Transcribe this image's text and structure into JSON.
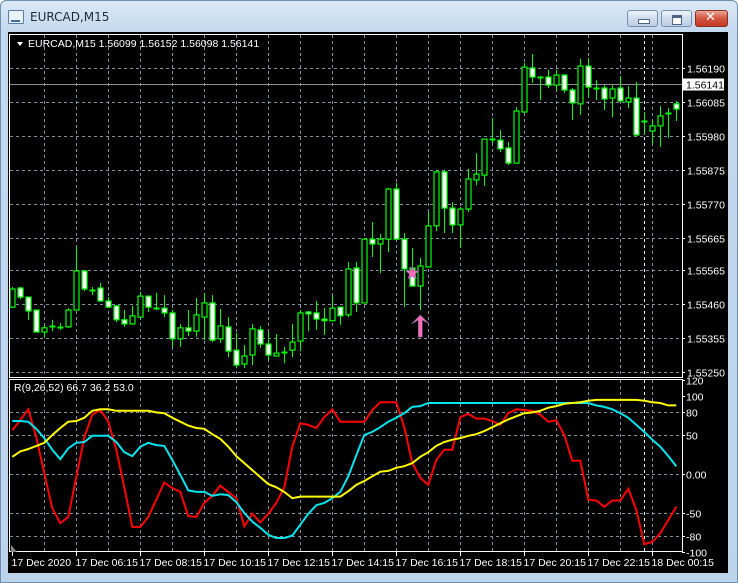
{
  "window": {
    "title": "EURCAD,M15",
    "buttons": {
      "minimize": "minimize",
      "maximize": "maximize",
      "close": "close"
    }
  },
  "chart_header": {
    "menu_icon": "triangle-down-icon",
    "text": "EURCAD,M15  1.56099 1.56152 1.56098 1.56141"
  },
  "indicator_header": {
    "text": "R(9,26,52) 66.7 36.2 53.0"
  },
  "colors": {
    "background": "#000000",
    "candle_outline": "#00ff00",
    "bear_body": "#ffffff",
    "bull_body": "#000000",
    "grid": "#8090a0",
    "red_line": "#ff0000",
    "cyan_line": "#00e5ee",
    "yellow_line": "#ffff00",
    "signal": "#ff6eb4"
  },
  "chart_data": [
    {
      "type": "candlestick",
      "symbol": "EURCAD",
      "timeframe": "M15",
      "bid": 1.56141,
      "bid_label": "1.56141",
      "y_ticks": [
        "1.56190",
        "1.56085",
        "1.55980",
        "1.55875",
        "1.55770",
        "1.55665",
        "1.55565",
        "1.55460",
        "1.55355",
        "1.55250"
      ],
      "x_tick_labels": [
        "17 Dec 2020",
        "17 Dec 06:15",
        "17 Dec 08:15",
        "17 Dec 10:15",
        "17 Dec 12:15",
        "17 Dec 14:15",
        "17 Dec 16:15",
        "17 Dec 18:15",
        "17 Dec 20:15",
        "17 Dec 22:15",
        "18 Dec 00:15"
      ],
      "grid": true,
      "day_separator_before": "18 Dec 00:15",
      "ohlc": [
        [
          1.55451,
          1.55513,
          1.55448,
          1.55507
        ],
        [
          1.5551,
          1.55513,
          1.55476,
          1.55482
        ],
        [
          1.55482,
          1.55482,
          1.55412,
          1.55439
        ],
        [
          1.55442,
          1.55442,
          1.55374,
          1.55374
        ],
        [
          1.55374,
          1.55396,
          1.55359,
          1.55387
        ],
        [
          1.55393,
          1.55412,
          1.55377,
          1.55393
        ],
        [
          1.5539,
          1.55402,
          1.55381,
          1.5539
        ],
        [
          1.5539,
          1.55448,
          1.55387,
          1.55442
        ],
        [
          1.55442,
          1.55637,
          1.55442,
          1.55563
        ],
        [
          1.55563,
          1.55563,
          1.55501,
          1.55507
        ],
        [
          1.55504,
          1.55513,
          1.55488,
          1.55504
        ],
        [
          1.5551,
          1.55526,
          1.55467,
          1.5547
        ],
        [
          1.5547,
          1.55482,
          1.55448,
          1.55451
        ],
        [
          1.55455,
          1.55458,
          1.55405,
          1.55412
        ],
        [
          1.55412,
          1.55442,
          1.5539,
          1.55399
        ],
        [
          1.55399,
          1.55455,
          1.55396,
          1.55424
        ],
        [
          1.5542,
          1.55498,
          1.5542,
          1.55485
        ],
        [
          1.55485,
          1.55485,
          1.55436,
          1.55451
        ],
        [
          1.55448,
          1.55495,
          1.55442,
          1.55448
        ],
        [
          1.55448,
          1.55488,
          1.5542,
          1.55433
        ],
        [
          1.55433,
          1.55442,
          1.55328,
          1.55353
        ],
        [
          1.55353,
          1.55399,
          1.55328,
          1.55387
        ],
        [
          1.55387,
          1.55442,
          1.55362,
          1.55377
        ],
        [
          1.55377,
          1.55479,
          1.55359,
          1.55427
        ],
        [
          1.5542,
          1.55495,
          1.55349,
          1.55464
        ],
        [
          1.55464,
          1.55488,
          1.55343,
          1.55349
        ],
        [
          1.55353,
          1.55445,
          1.5534,
          1.55393
        ],
        [
          1.5539,
          1.5542,
          1.55297,
          1.55315
        ],
        [
          1.55318,
          1.55371,
          1.55263,
          1.55272
        ],
        [
          1.55275,
          1.55334,
          1.55263,
          1.553
        ],
        [
          1.55303,
          1.55399,
          1.55272,
          1.55384
        ],
        [
          1.55381,
          1.55393,
          1.55325,
          1.55337
        ],
        [
          1.55337,
          1.55374,
          1.55288,
          1.55303
        ],
        [
          1.553,
          1.55368,
          1.553,
          1.55309
        ],
        [
          1.55312,
          1.55328,
          1.55278,
          1.55312
        ],
        [
          1.55318,
          1.55399,
          1.55297,
          1.55343
        ],
        [
          1.55346,
          1.55442,
          1.55315,
          1.55433
        ],
        [
          1.55436,
          1.55439,
          1.55377,
          1.5543
        ],
        [
          1.55433,
          1.5547,
          1.55381,
          1.55414
        ],
        [
          1.55414,
          1.55448,
          1.55365,
          1.55409
        ],
        [
          1.55409,
          1.55488,
          1.55409,
          1.55448
        ],
        [
          1.55451,
          1.55451,
          1.55396,
          1.55424
        ],
        [
          1.55427,
          1.5559,
          1.5542,
          1.55569
        ],
        [
          1.55572,
          1.5559,
          1.55436,
          1.55464
        ],
        [
          1.55464,
          1.55661,
          1.55464,
          1.55661
        ],
        [
          1.55661,
          1.55714,
          1.55606,
          1.55646
        ],
        [
          1.55646,
          1.55677,
          1.55556,
          1.55661
        ],
        [
          1.55661,
          1.55819,
          1.55621,
          1.55816
        ],
        [
          1.55816,
          1.55835,
          1.55661,
          1.55661
        ],
        [
          1.55661,
          1.5568,
          1.55451,
          1.55569
        ],
        [
          1.55572,
          1.55634,
          1.55516,
          1.55516
        ],
        [
          1.55516,
          1.55603,
          1.55442,
          1.55578
        ],
        [
          1.55575,
          1.55745,
          1.55575,
          1.55702
        ],
        [
          1.55702,
          1.55875,
          1.55686,
          1.55869
        ],
        [
          1.55869,
          1.55875,
          1.5568,
          1.55757
        ],
        [
          1.55757,
          1.55776,
          1.5568,
          1.55705
        ],
        [
          1.55705,
          1.5576,
          1.55634,
          1.55754
        ],
        [
          1.55754,
          1.55878,
          1.55745,
          1.55847
        ],
        [
          1.55844,
          1.55927,
          1.55828,
          1.55862
        ],
        [
          1.55859,
          1.5597,
          1.55825,
          1.5597
        ],
        [
          1.5597,
          1.56035,
          1.55958,
          1.5597
        ],
        [
          1.55967,
          1.55998,
          1.5593,
          1.5594
        ],
        [
          1.55943,
          1.55961,
          1.5589,
          1.55896
        ],
        [
          1.55896,
          1.56069,
          1.55896,
          1.56057
        ],
        [
          1.56054,
          1.56205,
          1.56051,
          1.56193
        ],
        [
          1.5619,
          1.56233,
          1.56144,
          1.56162
        ],
        [
          1.56162,
          1.56165,
          1.56091,
          1.56162
        ],
        [
          1.56162,
          1.56184,
          1.56128,
          1.56137
        ],
        [
          1.56137,
          1.56184,
          1.56119,
          1.56168
        ],
        [
          1.56168,
          1.56171,
          1.56113,
          1.56122
        ],
        [
          1.56122,
          1.56128,
          1.56029,
          1.56082
        ],
        [
          1.56079,
          1.56218,
          1.56045,
          1.56196
        ],
        [
          1.56196,
          1.56221,
          1.561,
          1.56131
        ],
        [
          1.56128,
          1.56153,
          1.56091,
          1.56128
        ],
        [
          1.56128,
          1.56137,
          1.5606,
          1.56094
        ],
        [
          1.56097,
          1.56137,
          1.56038,
          1.56125
        ],
        [
          1.56128,
          1.56165,
          1.56085,
          1.56088
        ],
        [
          1.56085,
          1.56134,
          1.56066,
          1.56097
        ],
        [
          1.56097,
          1.56147,
          1.5598,
          1.55983
        ],
        [
          1.56026,
          1.56054,
          1.55983,
          1.56023
        ],
        [
          1.55995,
          1.56029,
          1.55955,
          1.56011
        ],
        [
          1.56011,
          1.56072,
          1.55946,
          1.56042
        ],
        [
          1.56051,
          1.56066,
          1.55974,
          1.56051
        ],
        [
          1.56079,
          1.56088,
          1.56026,
          1.56063
        ]
      ],
      "signals": [
        {
          "type": "star",
          "candle": 50
        },
        {
          "type": "arrow-up",
          "candle": 51
        }
      ]
    },
    {
      "type": "line",
      "title": "R(9,26,52)",
      "y_ticks": [
        "120",
        "100",
        "80",
        "50",
        "0.00",
        "-50",
        "-80",
        "-100"
      ],
      "grid_levels": [
        80,
        50,
        0,
        -50,
        -80
      ],
      "series": [
        {
          "color": "#ff0000",
          "values": [
            56,
            69,
            83,
            47,
            1,
            -44,
            -63,
            -55,
            -4,
            47,
            76,
            82,
            67,
            31,
            -17,
            -68,
            -68,
            -55,
            -33,
            -11,
            -18,
            -23,
            -54,
            -55,
            -37,
            -28,
            -15,
            -23,
            -31,
            -67,
            -51,
            -62,
            -51,
            -37,
            -17,
            35,
            65,
            63,
            59,
            73,
            83,
            67,
            67,
            67,
            67,
            82,
            92,
            92,
            92,
            60,
            14,
            -5,
            -14,
            18,
            31,
            31,
            73,
            77,
            71,
            71,
            68,
            63,
            78,
            83,
            82,
            81,
            76,
            67,
            69,
            50,
            17,
            17,
            -33,
            -34,
            -42,
            -34,
            -34,
            -19,
            -46,
            -90,
            -87,
            -76,
            -59,
            -42
          ]
        },
        {
          "color": "#00e5ee",
          "values": [
            68,
            68,
            67,
            58,
            46,
            31,
            19,
            33,
            40,
            41,
            49,
            49,
            49,
            41,
            28,
            23,
            35,
            40,
            37,
            36,
            18,
            -1,
            -21,
            -23,
            -23,
            -28,
            -26,
            -27,
            -36,
            -50,
            -61,
            -69,
            -78,
            -82,
            -82,
            -79,
            -65,
            -51,
            -40,
            -37,
            -31,
            -23,
            -3,
            24,
            50,
            54,
            60,
            67,
            72,
            78,
            86,
            87,
            91,
            91,
            91,
            91,
            91,
            91,
            91,
            91,
            91,
            91,
            91,
            91,
            91,
            91,
            91,
            91,
            91,
            91,
            91,
            91,
            91,
            88,
            86,
            83,
            78,
            72,
            63,
            54,
            44,
            35,
            23,
            10
          ]
        },
        {
          "color": "#ffff00",
          "values": [
            22,
            29,
            32,
            36,
            40,
            50,
            59,
            67,
            68,
            72,
            81,
            83,
            83,
            81,
            81,
            81,
            81,
            81,
            79,
            78,
            72,
            67,
            62,
            59,
            58,
            51,
            45,
            35,
            23,
            14,
            5,
            -4,
            -13,
            -17,
            -23,
            -31,
            -29,
            -29,
            -29,
            -29,
            -29,
            -29,
            -22,
            -14,
            -9,
            -3,
            3,
            4,
            8,
            10,
            14,
            22,
            28,
            36,
            41,
            44,
            46,
            49,
            51,
            55,
            60,
            65,
            70,
            74,
            78,
            79,
            81,
            85,
            87,
            90,
            91,
            92,
            94,
            95,
            95,
            95,
            95,
            95,
            95,
            94,
            92,
            91,
            88,
            88
          ]
        }
      ]
    }
  ]
}
